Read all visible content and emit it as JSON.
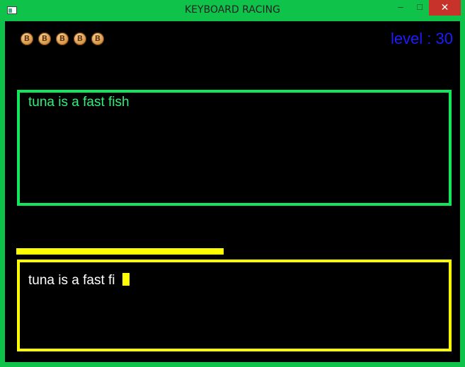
{
  "window": {
    "title": "KEYBOARD RACING",
    "controls": {
      "minimize": "–",
      "maximize": "□",
      "close": "✕"
    }
  },
  "hud": {
    "coins": [
      {
        "glyph": "B",
        "icon": "bitcoin-coin-icon"
      },
      {
        "glyph": "B",
        "icon": "bitcoin-coin-icon"
      },
      {
        "glyph": "B",
        "icon": "bitcoin-coin-icon"
      },
      {
        "glyph": "B",
        "icon": "bitcoin-coin-icon"
      },
      {
        "glyph": "B",
        "icon": "bitcoin-coin-icon"
      }
    ],
    "level_text": "level : 30"
  },
  "game": {
    "target_sentence": "tuna is a fast fish",
    "typed_text": "tuna is a fast fi",
    "progress_fraction": 0.48
  },
  "colors": {
    "frame": "#0ec24a",
    "target_border": "#10e85a",
    "target_text": "#2ff07a",
    "input_border": "#ffff00",
    "progress": "#ffff00",
    "level_text": "#1c1cff",
    "background": "#000000"
  }
}
